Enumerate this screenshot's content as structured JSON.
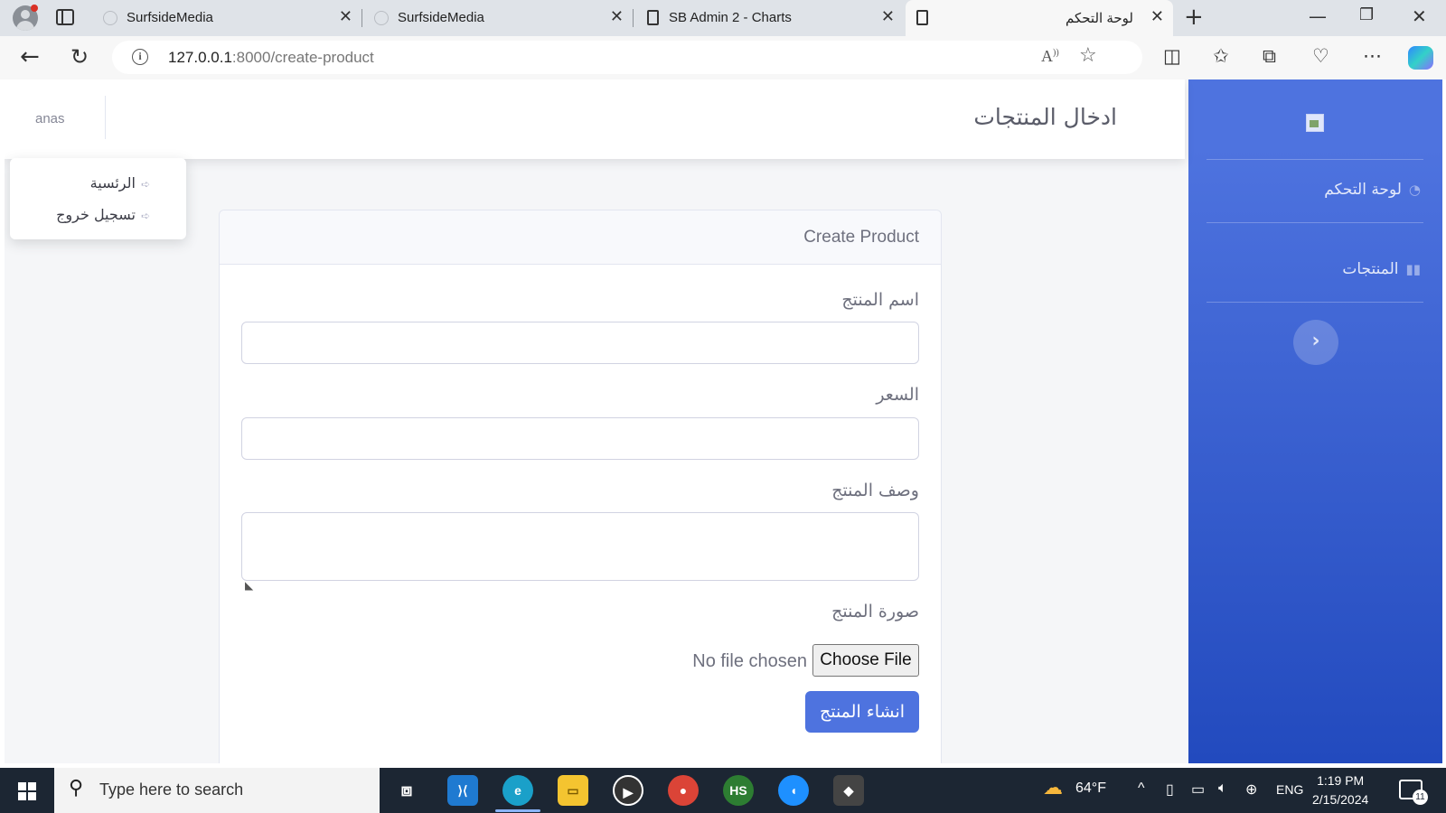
{
  "browser": {
    "tabs": [
      {
        "title": "SurfsideMedia",
        "active": false
      },
      {
        "title": "SurfsideMedia",
        "active": false
      },
      {
        "title": "SB Admin 2 - Charts",
        "active": false
      },
      {
        "title": "لوحة التحكم",
        "active": true
      }
    ],
    "url_host": "127.0.0.1",
    "url_path": ":8000/create-product"
  },
  "sidebar": {
    "items": [
      {
        "label": "لوحة التحكم",
        "icon": "tachometer-icon"
      },
      {
        "label": "المنتجات",
        "icon": "book-icon"
      }
    ]
  },
  "topbar": {
    "heading": "ادخال المنتجات",
    "user_name": "anas"
  },
  "user_menu": {
    "items": [
      {
        "label": "الرئسية",
        "icon": "sign-out-icon"
      },
      {
        "label": "تسجيل خروج",
        "icon": "sign-out-icon"
      }
    ]
  },
  "form": {
    "title": "Create Product",
    "name_label": "اسم المنتج",
    "name_value": "",
    "price_label": "السعر",
    "price_value": "",
    "description_label": "وصف المنتج",
    "description_value": "",
    "image_label": "صورة المنتج",
    "file_status": "No file chosen",
    "file_button": "Choose File",
    "submit_label": "انشاء المنتج"
  },
  "taskbar": {
    "search_placeholder": "Type here to search",
    "temperature": "64°F",
    "language": "ENG",
    "time": "1:19 PM",
    "date": "2/15/2024",
    "notification_count": "11"
  }
}
